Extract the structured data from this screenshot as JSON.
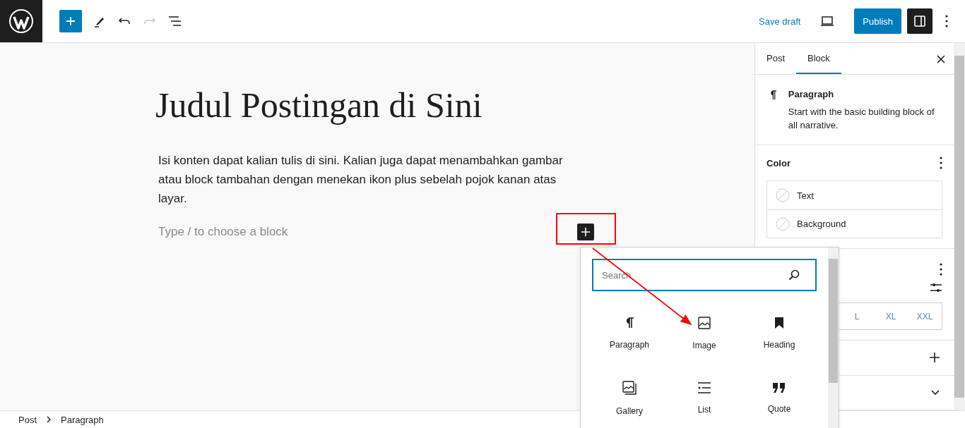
{
  "toolbar": {
    "redo_disabled": true,
    "save_draft": "Save draft",
    "publish": "Publish",
    "settings_pressed": true
  },
  "editor": {
    "title": "Judul Postingan di Sini",
    "paragraph": "Isi konten dapat kalian tulis di sini. Kalian juga dapat menambahkan gambar atau block tambahan dengan menekan ikon plus sebelah pojok kanan atas layar.",
    "placeholder": "Type / to choose a block"
  },
  "sidebar": {
    "tabs": [
      {
        "label": "Post",
        "selected": false
      },
      {
        "label": "Block",
        "selected": true
      }
    ],
    "block_card": {
      "title": "Paragraph",
      "description": "Start with the basic building block of all narrative."
    },
    "color": {
      "title": "Color",
      "items": [
        {
          "label": "Text"
        },
        {
          "label": "Background"
        }
      ]
    },
    "size_options": [
      "L",
      "XL",
      "XXL"
    ]
  },
  "inserter": {
    "placeholder": "Search",
    "blocks": [
      {
        "label": "Paragraph",
        "kind": "paragraph"
      },
      {
        "label": "Image",
        "kind": "image"
      },
      {
        "label": "Heading",
        "kind": "heading"
      },
      {
        "label": "Gallery",
        "kind": "gallery"
      },
      {
        "label": "List",
        "kind": "list"
      },
      {
        "label": "Quote",
        "kind": "quote"
      }
    ]
  },
  "breadcrumb": [
    "Post",
    "Paragraph"
  ]
}
